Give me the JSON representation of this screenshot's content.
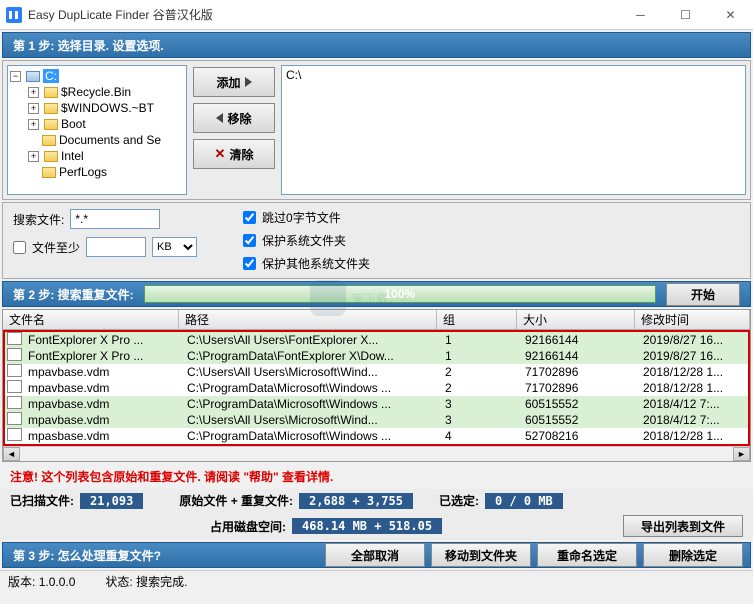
{
  "titlebar": {
    "title": "Easy DupLicate Finder 谷普汉化版"
  },
  "step1": {
    "label": "第 1 步:  选择目录. 设置选项."
  },
  "tree": {
    "root": "C:",
    "children": [
      "$Recycle.Bin",
      "$WINDOWS.~BT",
      "Boot",
      "Documents and Se",
      "Intel",
      "PerfLogs"
    ]
  },
  "buttons": {
    "add": "添加",
    "remove": "移除",
    "clear": "清除"
  },
  "selected_path": "C:\\",
  "options": {
    "search_label": "搜索文件:",
    "pattern": "*.*",
    "min_label": "文件至少",
    "min_unit": "KB",
    "skip_zero": "跳过0字节文件",
    "protect_sys": "保护系统文件夹",
    "protect_other": "保护其他系统文件夹"
  },
  "step2": {
    "label": "第 2 步:  搜索重复文件:",
    "progress": "100%",
    "start": "开始"
  },
  "columns": {
    "name": "文件名",
    "path": "路径",
    "group": "组",
    "size": "大小",
    "date": "修改时间"
  },
  "rows": [
    {
      "name": "FontExplorer X Pro ...",
      "path": "C:\\Users\\All Users\\FontExplorer X...",
      "grp": "1",
      "size": "92166144",
      "date": "2019/8/27 16..."
    },
    {
      "name": "FontExplorer X Pro ...",
      "path": "C:\\ProgramData\\FontExplorer X\\Dow...",
      "grp": "1",
      "size": "92166144",
      "date": "2019/8/27 16..."
    },
    {
      "name": "mpavbase.vdm",
      "path": "C:\\Users\\All Users\\Microsoft\\Wind...",
      "grp": "2",
      "size": "71702896",
      "date": "2018/12/28 1..."
    },
    {
      "name": "mpavbase.vdm",
      "path": "C:\\ProgramData\\Microsoft\\Windows ...",
      "grp": "2",
      "size": "71702896",
      "date": "2018/12/28 1..."
    },
    {
      "name": "mpavbase.vdm",
      "path": "C:\\ProgramData\\Microsoft\\Windows ...",
      "grp": "3",
      "size": "60515552",
      "date": "2018/4/12 7:..."
    },
    {
      "name": "mpavbase.vdm",
      "path": "C:\\Users\\All Users\\Microsoft\\Wind...",
      "grp": "3",
      "size": "60515552",
      "date": "2018/4/12 7:..."
    },
    {
      "name": "mpasbase.vdm",
      "path": "C:\\ProgramData\\Microsoft\\Windows ...",
      "grp": "4",
      "size": "52708216",
      "date": "2018/12/28 1..."
    }
  ],
  "notice": "注意!  这个列表包含原始和重复文件.  请阅读 \"帮助\" 查看详情.",
  "stats": {
    "scanned_label": "已扫描文件:",
    "scanned": "21,093",
    "orig_dup_label": "原始文件 + 重复文件:",
    "orig_dup": "2,688 + 3,755",
    "selected_label": "已选定:",
    "selected": "0 / 0 MB",
    "disk_label": "占用磁盘空间:",
    "disk": "468.14 MB + 518.05",
    "export": "导出列表到文件"
  },
  "step3": {
    "label": "第 3 步:  怎么处理重复文件?"
  },
  "actions": {
    "unselect": "全部取消",
    "move": "移动到文件夹",
    "rename": "重命名选定",
    "delete": "删除选定"
  },
  "status": {
    "version_label": "版本:",
    "version": "1.0.0.0",
    "state_label": "状态:",
    "state": "搜索完成."
  },
  "watermark": "安下载"
}
